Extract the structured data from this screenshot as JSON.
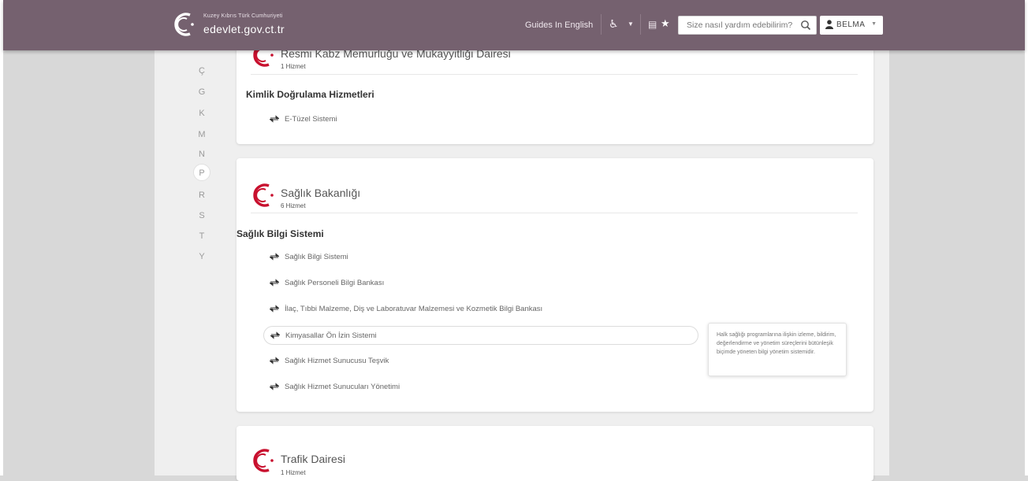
{
  "header": {
    "logo_top": "Kuzey Kıbrıs Türk Cumhuriyeti",
    "logo_main": "edevlet.gov.ct.tr",
    "guides_label": "Guides In English",
    "search_placeholder": "Size nasıl yardım edebilirim?",
    "user_name": "BELMA"
  },
  "alphabet": [
    "Ç",
    "G",
    "K",
    "M",
    "N",
    "P",
    "R",
    "S",
    "T",
    "Y"
  ],
  "active_letter": "P",
  "cards": [
    {
      "org_name": "Resmi Kabz Memurluğu ve Mukayyitliği Dairesi",
      "service_count": "1 Hizmet",
      "category": "Kimlik Doğrulama Hizmetleri",
      "services": [
        "E-Tüzel Sistemi"
      ]
    },
    {
      "org_name": "Sağlık Bakanlığı",
      "service_count": "6 Hizmet",
      "category": "Sağlık Bilgi Sistemi",
      "services": [
        "Sağlık Bilgi Sistemi",
        "Sağlık Personeli Bilgi Bankası",
        "İlaç, Tıbbi Malzeme, Diş ve Laboratuvar Malzemesi ve Kozmetik Bilgi Bankası",
        "Kimyasallar Ön İzin Sistemi",
        "Sağlık Hizmet Sunucusu Teşvik",
        "Sağlık Hizmet Sunucuları Yönetimi"
      ]
    },
    {
      "org_name": "Trafik Dairesi",
      "service_count": "1 Hizmet"
    }
  ],
  "tooltip_text": "Halk sağlığı programlarına ilişkin izleme, bildirim, değerlendirme ve yönetim süreçlerini bütünleşik biçimde yöneten bilgi yönetim sistemidir.",
  "colors": {
    "header_bg": "#75616f",
    "brand_red": "#c8102e"
  }
}
